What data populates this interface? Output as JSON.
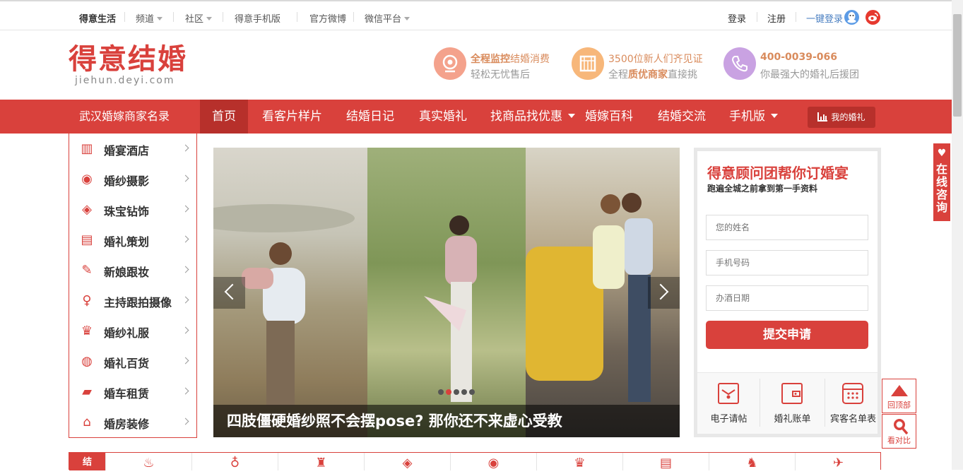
{
  "topbar": {
    "site": "得意生活",
    "channels": "频道",
    "community": "社区",
    "mobile": "得意手机版",
    "weibo": "官方微博",
    "wechat": "微信平台",
    "login": "登录",
    "register": "注册",
    "quick_login": "一键登录"
  },
  "header": {
    "logo_cn": "得意结婚",
    "logo_en": "jiehun.deyi.com",
    "features": [
      {
        "line1_bold": "全程监控",
        "line1_rest": "结婚消费",
        "line2": "轻松无忧售后",
        "icon": "camera-icon",
        "color": "#f4a28c"
      },
      {
        "line1_bold": "",
        "line1_rest": "3500位新人们齐见证",
        "line2_pre": "全程",
        "line2_bold": "质优商家",
        "line2_post": "直接挑",
        "icon": "shop-icon",
        "color": "#f7b77a"
      },
      {
        "line1_bold": "400-0039-066",
        "line1_rest": "",
        "line2": "你最强大的婚礼后援团",
        "icon": "phone-icon",
        "color": "#c9a2e2"
      }
    ]
  },
  "nav": {
    "directory": "武汉婚嫁商家名录",
    "items": [
      "首页",
      "看客片样片",
      "结婚日记",
      "真实婚礼",
      "找商品找优惠",
      "婚嫁百科",
      "结婚交流",
      "手机版"
    ],
    "my_wedding": "我的婚礼"
  },
  "side_menu": [
    {
      "label": "婚宴酒店",
      "icon": "hotel-icon",
      "glyph": "▥"
    },
    {
      "label": "婚纱摄影",
      "icon": "camera-icon",
      "glyph": "◉"
    },
    {
      "label": "珠宝钻饰",
      "icon": "diamond-icon",
      "glyph": "◈"
    },
    {
      "label": "婚礼策划",
      "icon": "planner-icon",
      "glyph": "▤"
    },
    {
      "label": "新娘跟妆",
      "icon": "makeup-icon",
      "glyph": "✎"
    },
    {
      "label": "主持跟拍摄像",
      "icon": "microphone-icon",
      "glyph": "♀"
    },
    {
      "label": "婚纱礼服",
      "icon": "dress-icon",
      "glyph": "♛"
    },
    {
      "label": "婚礼百货",
      "icon": "gift-icon",
      "glyph": "◍"
    },
    {
      "label": "婚车租赁",
      "icon": "car-icon",
      "glyph": "▰"
    },
    {
      "label": "婚房装修",
      "icon": "house-icon",
      "glyph": "⌂"
    }
  ],
  "banner": {
    "caption": "四肢僵硬婚纱照不会摆pose? 那你还不来虚心受教",
    "active_slide": 2,
    "slide_count": 5
  },
  "form": {
    "title": "得意顾问团帮你订婚宴",
    "subtitle": "跑遍全城之前拿到第一手资料",
    "name_placeholder": "您的姓名",
    "phone_placeholder": "手机号码",
    "date_placeholder": "办酒日期",
    "submit": "提交申请",
    "tools": [
      "电子请帖",
      "婚礼账单",
      "宾客名单表"
    ]
  },
  "widgets": {
    "online": "在线咨询",
    "top": "回顶部",
    "compare": "看对比"
  },
  "bottom": {
    "label": "结"
  },
  "colors": {
    "brand": "#d9413c",
    "nav_active": "#b7302b"
  }
}
